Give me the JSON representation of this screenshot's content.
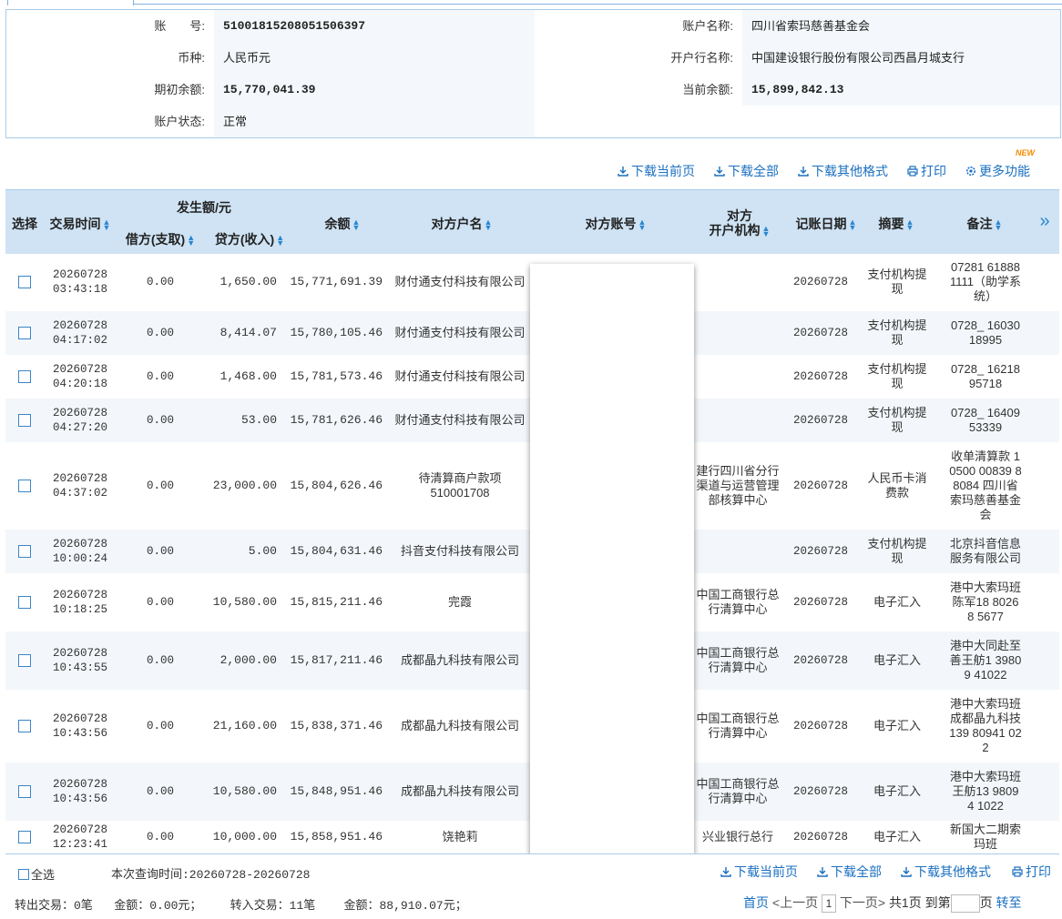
{
  "account": {
    "account_no_label": "账　　号:",
    "account_no": "51001815208051506397",
    "account_name_label": "账户名称:",
    "account_name": "四川省索玛慈善基金会",
    "currency_label": "币种:",
    "currency": "人民币元",
    "bank_label": "开户行名称:",
    "bank": "中国建设银行股份有限公司西昌月城支行",
    "opening_balance_label": "期初余额:",
    "opening_balance": "15,770,041.39",
    "current_balance_label": "当前余额:",
    "current_balance": "15,899,842.13",
    "status_label": "账户状态:",
    "status": "正常"
  },
  "toolbar": {
    "download_page": "下载当前页",
    "download_all": "下载全部",
    "download_other": "下载其他格式",
    "print": "打印",
    "more": "更多功能",
    "new_badge": "NEW"
  },
  "table": {
    "headers": {
      "select": "选择",
      "time": "交易时间",
      "amount_group": "发生额/元",
      "debit": "借方(支取)",
      "credit": "贷方(收入)",
      "balance": "余额",
      "counterparty": "对方户名",
      "counter_account": "对方账号",
      "counter_bank_1": "对方",
      "counter_bank_2": "开户机构",
      "book_date": "记账日期",
      "summary": "摘要",
      "remark": "备注",
      "more": "»"
    },
    "rows": [
      {
        "date": "20260728",
        "time": "03:43:18",
        "debit": "0.00",
        "credit": "1,650.00",
        "balance": "15,771,691.39",
        "party": "财付通支付科技有限公司",
        "bank": "",
        "book": "20260728",
        "summary": "支付机构提现",
        "remark": "07281 61888 1111（助学系统）"
      },
      {
        "date": "20260728",
        "time": "04:17:02",
        "debit": "0.00",
        "credit": "8,414.07",
        "balance": "15,780,105.46",
        "party": "财付通支付科技有限公司",
        "bank": "",
        "book": "20260728",
        "summary": "支付机构提现",
        "remark": "0728_ 16030 18995"
      },
      {
        "date": "20260728",
        "time": "04:20:18",
        "debit": "0.00",
        "credit": "1,468.00",
        "balance": "15,781,573.46",
        "party": "财付通支付科技有限公司",
        "bank": "",
        "book": "20260728",
        "summary": "支付机构提现",
        "remark": "0728_ 16218 95718"
      },
      {
        "date": "20260728",
        "time": "04:27:20",
        "debit": "0.00",
        "credit": "53.00",
        "balance": "15,781,626.46",
        "party": "财付通支付科技有限公司",
        "bank": "",
        "book": "20260728",
        "summary": "支付机构提现",
        "remark": "0728_ 16409 53339"
      },
      {
        "date": "20260728",
        "time": "04:37:02",
        "debit": "0.00",
        "credit": "23,000.00",
        "balance": "15,804,626.46",
        "party": "待清算商户款项510001708",
        "bank": "建行四川省分行渠道与运营管理部核算中心",
        "book": "20260728",
        "summary": "人民币卡消费款",
        "remark": "收单清算款 10500 00839 88084 四川省索玛慈善基金会"
      },
      {
        "date": "20260728",
        "time": "10:00:24",
        "debit": "0.00",
        "credit": "5.00",
        "balance": "15,804,631.46",
        "party": "抖音支付科技有限公司",
        "bank": "",
        "book": "20260728",
        "summary": "支付机构提现",
        "remark": "北京抖音信息服务有限公司"
      },
      {
        "date": "20260728",
        "time": "10:18:25",
        "debit": "0.00",
        "credit": "10,580.00",
        "balance": "15,815,211.46",
        "party": "完霞",
        "bank": "中国工商银行总行清算中心",
        "book": "20260728",
        "summary": "电子汇入",
        "remark": "港中大索玛班陈军18 80268 5677"
      },
      {
        "date": "20260728",
        "time": "10:43:55",
        "debit": "0.00",
        "credit": "2,000.00",
        "balance": "15,817,211.46",
        "party": "成都晶九科技有限公司",
        "bank": "中国工商银行总行清算中心",
        "book": "20260728",
        "summary": "电子汇入",
        "remark": "港中大同赴至善王舫1 39809 41022"
      },
      {
        "date": "20260728",
        "time": "10:43:56",
        "debit": "0.00",
        "credit": "21,160.00",
        "balance": "15,838,371.46",
        "party": "成都晶九科技有限公司",
        "bank": "中国工商银行总行清算中心",
        "book": "20260728",
        "summary": "电子汇入",
        "remark": "港中大索玛班成都晶九科技139 80941 022"
      },
      {
        "date": "20260728",
        "time": "10:43:56",
        "debit": "0.00",
        "credit": "10,580.00",
        "balance": "15,848,951.46",
        "party": "成都晶九科技有限公司",
        "bank": "中国工商银行总行清算中心",
        "book": "20260728",
        "summary": "电子汇入",
        "remark": "港中大索玛班王舫13 98094 1022"
      },
      {
        "date": "20260728",
        "time": "12:23:41",
        "debit": "0.00",
        "credit": "10,000.00",
        "balance": "15,858,951.46",
        "party": "饶艳莉",
        "bank": "兴业银行总行",
        "book": "20260728",
        "summary": "电子汇入",
        "remark": "新国大二期索玛班"
      }
    ]
  },
  "footer": {
    "select_all": "全选",
    "query_time": "本次查询时间:20260728-20260728",
    "download_page": "下载当前页",
    "download_all": "下载全部",
    "download_other": "下载其他格式",
    "print": "打印",
    "out_tx": "转出交易：0笔",
    "out_amount": "金额：0.00元；",
    "in_tx": "转入交易：11笔",
    "in_amount": "金额：88,910.07元；",
    "first": "首页",
    "prev": "<上一页",
    "page": "1",
    "next": "下一页>",
    "total": "共1页",
    "goto": "到第",
    "page_unit": "页",
    "go": "转至"
  }
}
